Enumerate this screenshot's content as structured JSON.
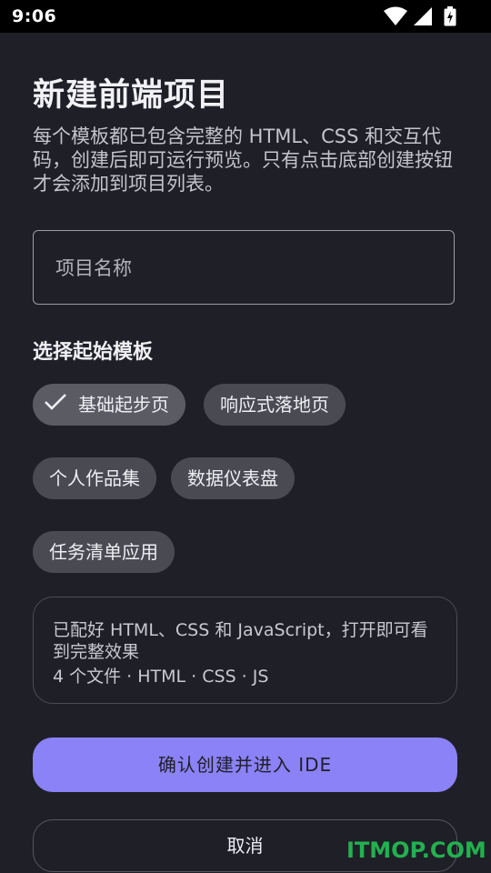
{
  "status_bar": {
    "time": "9:06"
  },
  "header": {
    "title": "新建前端项目",
    "description": "每个模板都已包含完整的 HTML、CSS 和交互代码，创建后即可运行预览。只有点击底部创建按钮才会添加到项目列表。"
  },
  "form": {
    "name_placeholder": "项目名称",
    "name_value": "",
    "template_section_label": "选择起始模板"
  },
  "templates": [
    {
      "label": "基础起步页",
      "selected": true
    },
    {
      "label": "响应式落地页",
      "selected": false
    },
    {
      "label": "个人作品集",
      "selected": false
    },
    {
      "label": "数据仪表盘",
      "selected": false
    },
    {
      "label": "任务清单应用",
      "selected": false
    }
  ],
  "info_card": {
    "description": "已配好 HTML、CSS 和 JavaScript，打开即可看到完整效果",
    "files": "4 个文件 · HTML · CSS · JS"
  },
  "actions": {
    "confirm_label": "确认创建并进入 IDE",
    "cancel_label": "取消"
  },
  "watermark": "ITMOP.COM",
  "colors": {
    "background": "#1f2027",
    "accent": "#8b82f8",
    "chip": "#4a4b52",
    "watermark": "#24b04f"
  }
}
